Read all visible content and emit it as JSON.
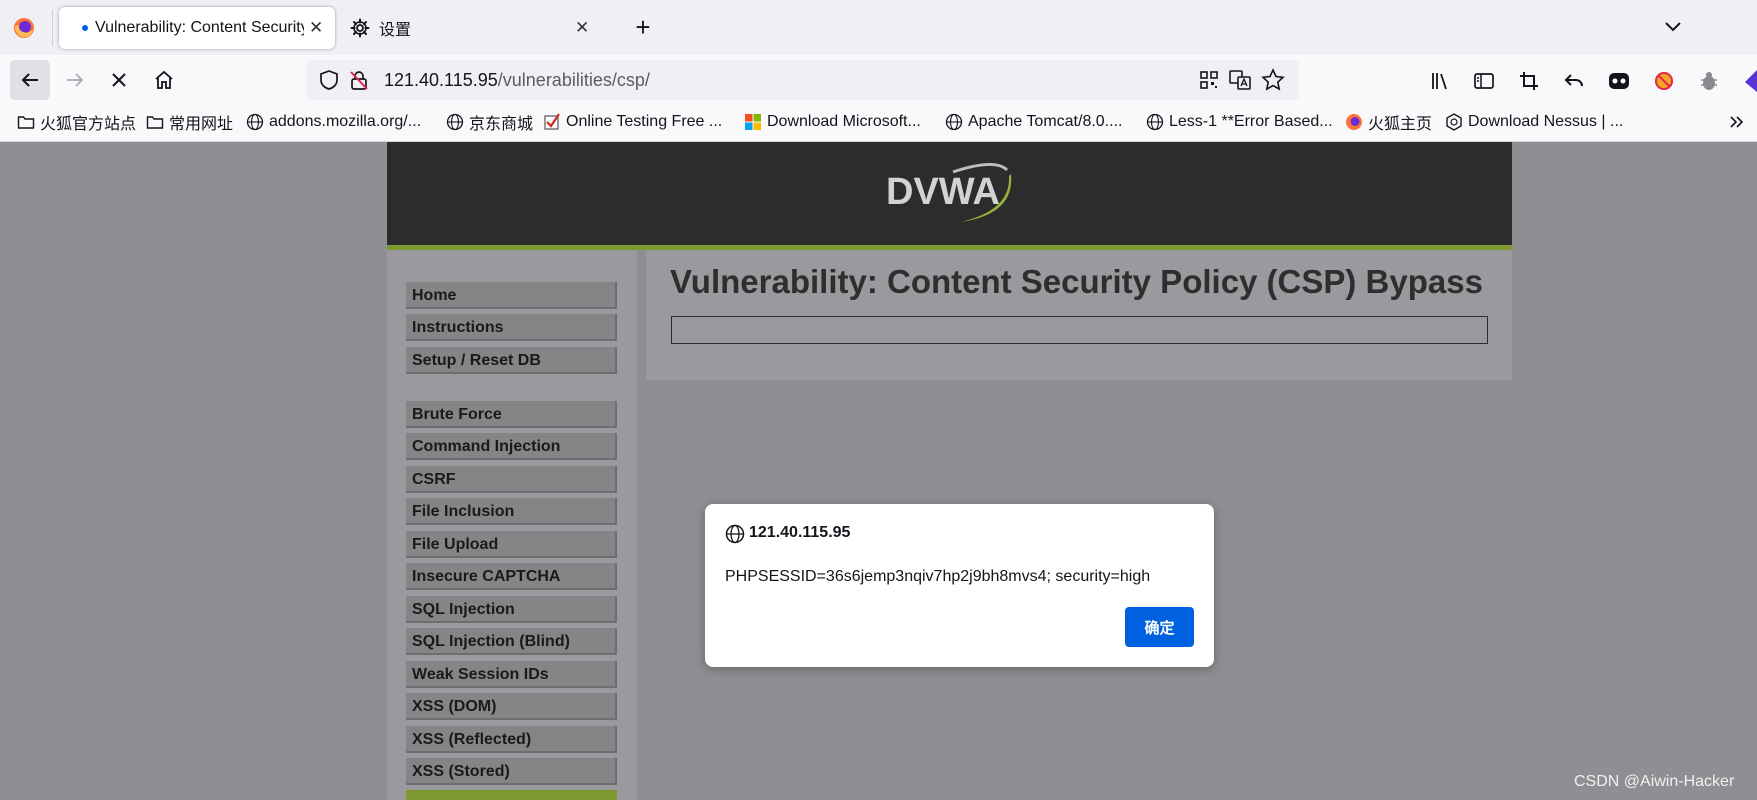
{
  "tabs": [
    {
      "title": "Vulnerability: Content Security Policy (CSP) Bypass",
      "active": true
    },
    {
      "title": "设置",
      "active": false
    }
  ],
  "address": {
    "host": "121.40.115.95",
    "path": "/vulnerabilities/csp/"
  },
  "bookmarks": [
    {
      "label": "火狐官方站点",
      "icon": "folder-icon"
    },
    {
      "label": "常用网址",
      "icon": "folder-icon"
    },
    {
      "label": "addons.mozilla.org/...",
      "icon": "globe-icon"
    },
    {
      "label": "京东商城",
      "icon": "globe-icon"
    },
    {
      "label": "Online Testing Free ...",
      "icon": "checkmark-icon"
    },
    {
      "label": "Download Microsoft...",
      "icon": "microsoft-icon"
    },
    {
      "label": "Apache Tomcat/8.0....",
      "icon": "globe-icon"
    },
    {
      "label": "Less-1 **Error Based...",
      "icon": "globe-icon"
    },
    {
      "label": "火狐主页",
      "icon": "firefox-icon"
    },
    {
      "label": "Download Nessus | ...",
      "icon": "nessus-icon"
    }
  ],
  "dvwa": {
    "logo": "DVWA",
    "title": "Vulnerability: Content Security Policy (CSP) Bypass",
    "menu": [
      "Home",
      "Instructions",
      "Setup / Reset DB",
      "Brute Force",
      "Command Injection",
      "CSRF",
      "File Inclusion",
      "File Upload",
      "Insecure CAPTCHA",
      "SQL Injection",
      "SQL Injection (Blind)",
      "Weak Session IDs",
      "XSS (DOM)",
      "XSS (Reflected)",
      "XSS (Stored)"
    ]
  },
  "dialog": {
    "host": "121.40.115.95",
    "message": "PHPSESSID=36s6jemp3nqiv7hp2j9bh8mvs4; security=high",
    "ok_label": "确定"
  },
  "watermark": "CSDN @Aiwin-Hacker",
  "colors": {
    "accent": "#7d9a32",
    "button": "#0061e0",
    "header": "#2c2c2d"
  }
}
